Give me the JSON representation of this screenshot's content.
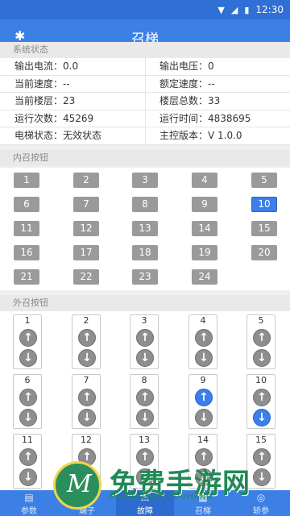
{
  "statusbar": {
    "time": "12:30"
  },
  "appbar": {
    "title": "召梯"
  },
  "sections": {
    "system_status": "系统状态",
    "inner_call": "内召按钮",
    "outer_call": "外召按钮"
  },
  "status_rows": [
    [
      "输出电流：0.0",
      "输出电压：0"
    ],
    [
      "当前速度：--",
      "额定速度：--"
    ],
    [
      "当前楼层：23",
      "楼层总数：33"
    ],
    [
      "运行次数：45269",
      "运行时间：4838695"
    ],
    [
      "电梯状态：无效状态",
      "主控版本：V 1.0.0"
    ]
  ],
  "inner_buttons": [
    "1",
    "2",
    "3",
    "4",
    "5",
    "6",
    "7",
    "8",
    "9",
    "10",
    "11",
    "12",
    "13",
    "14",
    "15",
    "16",
    "17",
    "18",
    "19",
    "20",
    "21",
    "22",
    "23",
    "24"
  ],
  "inner_active": "10",
  "outer_floors": [
    "1",
    "2",
    "3",
    "4",
    "5",
    "6",
    "7",
    "8",
    "9",
    "10",
    "11",
    "12",
    "13",
    "14",
    "15"
  ],
  "outer_active_up": [
    "9"
  ],
  "outer_active_down": [
    "10"
  ],
  "bottom_nav": [
    {
      "label": "参数",
      "icon": "list-icon"
    },
    {
      "label": "端子",
      "icon": "terminal-icon"
    },
    {
      "label": "故障",
      "icon": "warning-icon"
    },
    {
      "label": "召梯",
      "icon": "elevator-icon"
    },
    {
      "label": "轿参",
      "icon": "car-icon"
    }
  ],
  "bottom_nav_active": "故障",
  "watermark": {
    "text": "免费手游网",
    "sub": "MIANFEISHOUYOUWANG",
    "logo_letter": "M"
  },
  "colors": {
    "primary": "#3c80e6",
    "active_button": "#3c7fe8",
    "inactive_button": "#9a9a9a"
  }
}
